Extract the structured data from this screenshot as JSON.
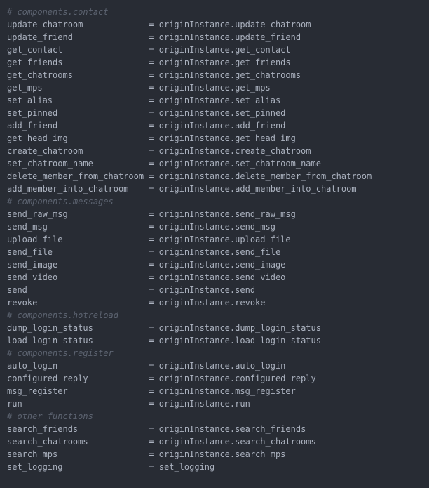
{
  "comment_prefix": "# ",
  "assign_obj": "originInstance",
  "align_col": 28,
  "sections": [
    {
      "title": "components.contact",
      "lines": [
        {
          "lhs": "update_chatroom",
          "rhs_obj": "originInstance",
          "rhs_attr": "update_chatroom"
        },
        {
          "lhs": "update_friend",
          "rhs_obj": "originInstance",
          "rhs_attr": "update_friend"
        },
        {
          "lhs": "get_contact",
          "rhs_obj": "originInstance",
          "rhs_attr": "get_contact"
        },
        {
          "lhs": "get_friends",
          "rhs_obj": "originInstance",
          "rhs_attr": "get_friends"
        },
        {
          "lhs": "get_chatrooms",
          "rhs_obj": "originInstance",
          "rhs_attr": "get_chatrooms"
        },
        {
          "lhs": "get_mps",
          "rhs_obj": "originInstance",
          "rhs_attr": "get_mps"
        },
        {
          "lhs": "set_alias",
          "rhs_obj": "originInstance",
          "rhs_attr": "set_alias"
        },
        {
          "lhs": "set_pinned",
          "rhs_obj": "originInstance",
          "rhs_attr": "set_pinned"
        },
        {
          "lhs": "add_friend",
          "rhs_obj": "originInstance",
          "rhs_attr": "add_friend"
        },
        {
          "lhs": "get_head_img",
          "rhs_obj": "originInstance",
          "rhs_attr": "get_head_img"
        },
        {
          "lhs": "create_chatroom",
          "rhs_obj": "originInstance",
          "rhs_attr": "create_chatroom"
        },
        {
          "lhs": "set_chatroom_name",
          "rhs_obj": "originInstance",
          "rhs_attr": "set_chatroom_name"
        },
        {
          "lhs": "delete_member_from_chatroom",
          "rhs_obj": "originInstance",
          "rhs_attr": "delete_member_from_chatroom"
        },
        {
          "lhs": "add_member_into_chatroom",
          "rhs_obj": "originInstance",
          "rhs_attr": "add_member_into_chatroom"
        }
      ]
    },
    {
      "title": "components.messages",
      "lines": [
        {
          "lhs": "send_raw_msg",
          "rhs_obj": "originInstance",
          "rhs_attr": "send_raw_msg"
        },
        {
          "lhs": "send_msg",
          "rhs_obj": "originInstance",
          "rhs_attr": "send_msg"
        },
        {
          "lhs": "upload_file",
          "rhs_obj": "originInstance",
          "rhs_attr": "upload_file"
        },
        {
          "lhs": "send_file",
          "rhs_obj": "originInstance",
          "rhs_attr": "send_file"
        },
        {
          "lhs": "send_image",
          "rhs_obj": "originInstance",
          "rhs_attr": "send_image"
        },
        {
          "lhs": "send_video",
          "rhs_obj": "originInstance",
          "rhs_attr": "send_video"
        },
        {
          "lhs": "send",
          "rhs_obj": "originInstance",
          "rhs_attr": "send"
        },
        {
          "lhs": "revoke",
          "rhs_obj": "originInstance",
          "rhs_attr": "revoke"
        }
      ]
    },
    {
      "title": "components.hotreload",
      "lines": [
        {
          "lhs": "dump_login_status",
          "rhs_obj": "originInstance",
          "rhs_attr": "dump_login_status"
        },
        {
          "lhs": "load_login_status",
          "rhs_obj": "originInstance",
          "rhs_attr": "load_login_status"
        }
      ]
    },
    {
      "title": "components.register",
      "lines": [
        {
          "lhs": "auto_login",
          "rhs_obj": "originInstance",
          "rhs_attr": "auto_login"
        },
        {
          "lhs": "configured_reply",
          "rhs_obj": "originInstance",
          "rhs_attr": "configured_reply"
        },
        {
          "lhs": "msg_register",
          "rhs_obj": "originInstance",
          "rhs_attr": "msg_register"
        },
        {
          "lhs": "run",
          "rhs_obj": "originInstance",
          "rhs_attr": "run"
        }
      ]
    },
    {
      "title": "other functions",
      "lines": [
        {
          "lhs": "search_friends",
          "rhs_obj": "originInstance",
          "rhs_attr": "search_friends"
        },
        {
          "lhs": "search_chatrooms",
          "rhs_obj": "originInstance",
          "rhs_attr": "search_chatrooms"
        },
        {
          "lhs": "search_mps",
          "rhs_obj": "originInstance",
          "rhs_attr": "search_mps"
        },
        {
          "lhs": "set_logging",
          "rhs_obj": null,
          "rhs_attr": "set_logging"
        }
      ]
    }
  ]
}
